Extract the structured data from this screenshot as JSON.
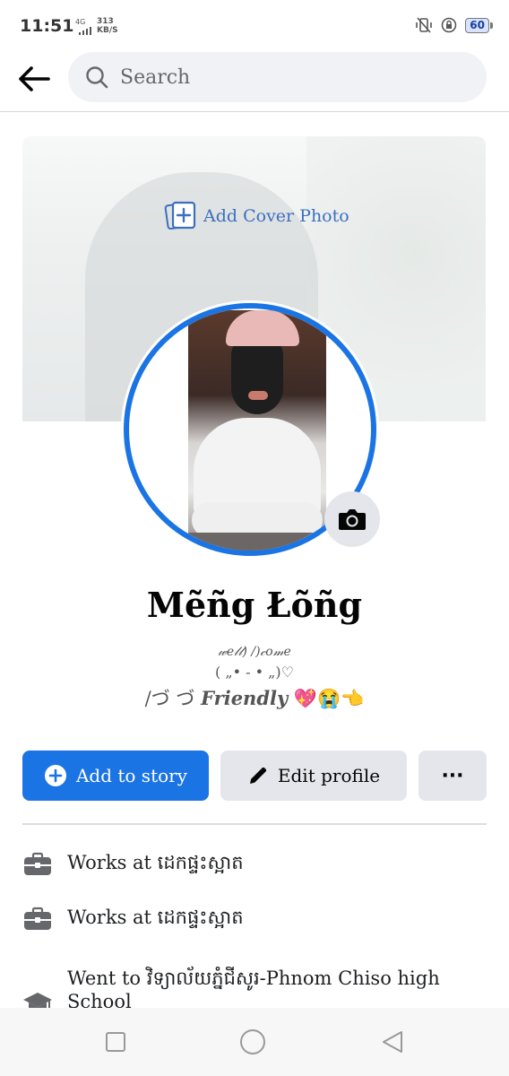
{
  "status_bar": {
    "time": "11:51",
    "network": "4G",
    "speed_value": "313",
    "speed_unit": "KB/S",
    "battery": "60"
  },
  "header": {
    "search_placeholder": "Search"
  },
  "cover": {
    "add_cover_label": "Add Cover Photo"
  },
  "profile": {
    "name": "Mẽñg Łõñg",
    "bio_line1": "𝓌𝑒𝓁𝓁)  /)𝒸𝑜𝓂𝑒",
    "bio_line2": "( „• - • „)♡",
    "bio_line3_prefix": "/づ  づ",
    "bio_line3_bold": "Friendly",
    "bio_line3_emoji": "💖😭👈"
  },
  "actions": {
    "add_story_label": "Add to story",
    "edit_profile_label": "Edit profile",
    "more_label": "···"
  },
  "info": {
    "work1": "Works at ដេកផ្ទះស្អាត",
    "work2": "Works at ដេកផ្ទះស្អាត",
    "education": "Went to វិទ្យាល័យភ្នំជីសូរ-Phnom Chiso high School"
  },
  "colors": {
    "accent": "#1b74e4",
    "button_gray": "#e4e6eb",
    "search_bg": "#f0f2f5"
  }
}
